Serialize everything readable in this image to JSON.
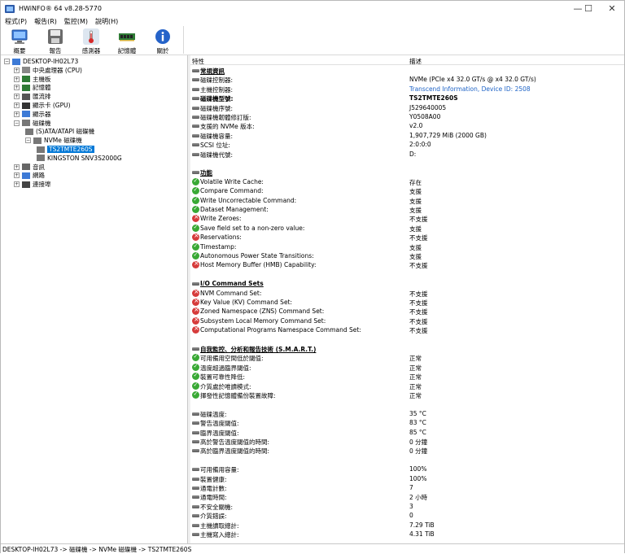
{
  "window": {
    "title": "HWiNFO® 64 v8.28-5770",
    "min": "—",
    "max": "☐",
    "close": "✕"
  },
  "menu": [
    "程式(P)",
    "報告(R)",
    "監控(M)",
    "說明(H)"
  ],
  "toolbar": [
    {
      "label": "概要",
      "icon": "monitor-icon"
    },
    {
      "label": "報告",
      "icon": "save-icon"
    },
    {
      "label": "感測器",
      "icon": "thermometer-icon"
    },
    {
      "label": "記憶體",
      "icon": "memory-icon"
    },
    {
      "label": "關於",
      "icon": "info-icon"
    }
  ],
  "tree": [
    {
      "label": "DESKTOP-IH02L73",
      "exp": "-"
    },
    {
      "label": "中央處理器 (CPU)",
      "exp": "+"
    },
    {
      "label": "主機板",
      "exp": "+"
    },
    {
      "label": "記憶體",
      "exp": "+"
    },
    {
      "label": "匯流排",
      "exp": "+"
    },
    {
      "label": "顯示卡 (GPU)",
      "exp": "+"
    },
    {
      "label": "顯示器",
      "exp": "+"
    },
    {
      "label": "磁碟機",
      "exp": "-"
    },
    {
      "label": "(S)ATA/ATAPI 磁碟機",
      "exp": ""
    },
    {
      "label": "NVMe 磁碟機",
      "exp": "-"
    },
    {
      "label": "TS2TMTE260S",
      "exp": ""
    },
    {
      "label": "KINGSTON SNV3S2000G",
      "exp": ""
    },
    {
      "label": "音訊",
      "exp": "+"
    },
    {
      "label": "網路",
      "exp": "+"
    },
    {
      "label": "連接埠",
      "exp": "+"
    }
  ],
  "columns": {
    "feature": "特性",
    "desc": "描述"
  },
  "rows": [
    {
      "t": "sec",
      "k": "常規資訊"
    },
    {
      "t": "dot",
      "k": "磁碟控制器:",
      "v": "NVMe (PCIe x4 32.0 GT/s @ x4 32.0 GT/s)"
    },
    {
      "t": "dot",
      "k": "主機控制器:",
      "v": "Transcend Information, Device ID: 2508",
      "link": true
    },
    {
      "t": "dotb",
      "k": "磁碟機型號:",
      "v": "TS2TMTE260S"
    },
    {
      "t": "dot",
      "k": "磁碟機序號:",
      "v": "J529640005"
    },
    {
      "t": "dot",
      "k": "磁碟機韌體修訂版:",
      "v": "Y0508A00"
    },
    {
      "t": "dot",
      "k": "支援的 NVMe 版本:",
      "v": "v2.0"
    },
    {
      "t": "dot",
      "k": "磁碟機容量:",
      "v": "1,907,729 MiB (2000 GB)"
    },
    {
      "t": "dot",
      "k": "SCSI 位址:",
      "v": "2:0:0:0"
    },
    {
      "t": "dot",
      "k": "磁碟機代號:",
      "v": "D:"
    },
    {
      "t": "blank"
    },
    {
      "t": "sec",
      "k": "功能"
    },
    {
      "t": "ok",
      "k": "Volatile Write Cache:",
      "v": "存在"
    },
    {
      "t": "ok",
      "k": "Compare Command:",
      "v": "支援"
    },
    {
      "t": "ok",
      "k": "Write Uncorrectable Command:",
      "v": "支援"
    },
    {
      "t": "ok",
      "k": "Dataset Management:",
      "v": "支援"
    },
    {
      "t": "no",
      "k": "Write Zeroes:",
      "v": "不支援"
    },
    {
      "t": "ok",
      "k": "Save field set to a non-zero value:",
      "v": "支援"
    },
    {
      "t": "no",
      "k": "Reservations:",
      "v": "不支援"
    },
    {
      "t": "ok",
      "k": "Timestamp:",
      "v": "支援"
    },
    {
      "t": "ok",
      "k": "Autonomous Power State Transitions:",
      "v": "支援"
    },
    {
      "t": "no",
      "k": "Host Memory Buffer (HMB) Capability:",
      "v": "不支援"
    },
    {
      "t": "blank"
    },
    {
      "t": "sec",
      "k": "I/O Command Sets"
    },
    {
      "t": "no",
      "k": "NVM Command Set:",
      "v": "不支援"
    },
    {
      "t": "no",
      "k": "Key Value (KV) Command Set:",
      "v": "不支援"
    },
    {
      "t": "no",
      "k": "Zoned Namespace (ZNS) Command Set:",
      "v": "不支援"
    },
    {
      "t": "no",
      "k": "Subsystem Local Memory Command Set:",
      "v": "不支援"
    },
    {
      "t": "no",
      "k": "Computational Programs Namespace Command Set:",
      "v": "不支援"
    },
    {
      "t": "blank"
    },
    {
      "t": "sec",
      "k": "自我監控、分析和報告技術 (S.M.A.R.T.)"
    },
    {
      "t": "ok",
      "k": "可用備用空間低於閾值:",
      "v": "正常"
    },
    {
      "t": "ok",
      "k": "溫度超過臨界閾值:",
      "v": "正常"
    },
    {
      "t": "ok",
      "k": "裝置可靠性降低:",
      "v": "正常"
    },
    {
      "t": "ok",
      "k": "介質處於唯讀模式:",
      "v": "正常"
    },
    {
      "t": "ok",
      "k": "揮發性記憶體備份裝置故障:",
      "v": "正常"
    },
    {
      "t": "blank"
    },
    {
      "t": "dot",
      "k": "磁碟溫度:",
      "v": "35 °C"
    },
    {
      "t": "dot",
      "k": "警告溫度閾值:",
      "v": "83 °C"
    },
    {
      "t": "dot",
      "k": "臨界溫度閾值:",
      "v": "85 °C"
    },
    {
      "t": "dot",
      "k": "高於警告溫度閾值的時間:",
      "v": "0 分鐘"
    },
    {
      "t": "dot",
      "k": "高於臨界溫度閾值的時間:",
      "v": "0 分鐘"
    },
    {
      "t": "blank"
    },
    {
      "t": "dot",
      "k": "可用備用容量:",
      "v": "100%"
    },
    {
      "t": "dot",
      "k": "裝置健康:",
      "v": "100%"
    },
    {
      "t": "dot",
      "k": "通電計數:",
      "v": "7"
    },
    {
      "t": "dot",
      "k": "通電時間:",
      "v": "2 小時"
    },
    {
      "t": "dot",
      "k": "不安全關機:",
      "v": "3"
    },
    {
      "t": "dot",
      "k": "介質錯誤:",
      "v": "0"
    },
    {
      "t": "dot",
      "k": "主機讀取總計:",
      "v": "7.29 TiB"
    },
    {
      "t": "dot",
      "k": "主機寫入總計:",
      "v": "4.31 TiB"
    }
  ],
  "status": "DESKTOP-IH02L73 -> 磁碟機 -> NVMe 磁碟機 -> TS2TMTE260S",
  "colors": {
    "selection": "#0078d7",
    "ok": "#39a935",
    "error": "#d63b3b",
    "link": "#1e63c6"
  }
}
